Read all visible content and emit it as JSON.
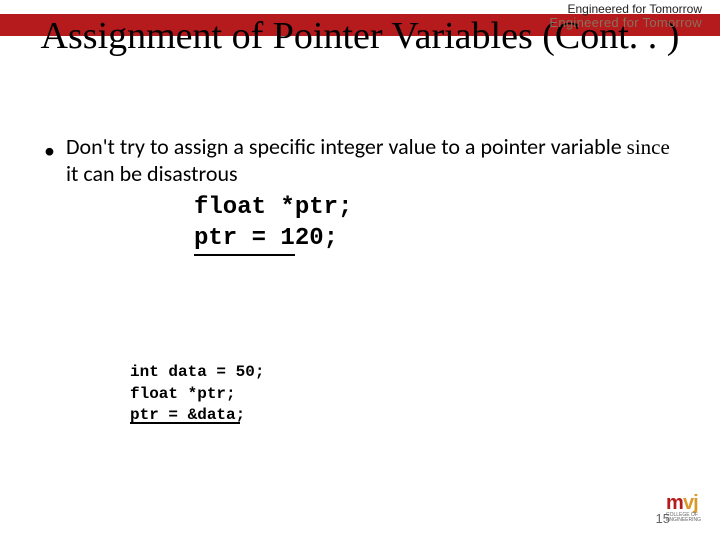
{
  "header": {
    "tagline1": "Engineered for Tomorrow",
    "tagline2": "Engineered for Tomorrow"
  },
  "title": "Assignment of Pointer Variables (Cont. . )",
  "bullet": {
    "lead": "Don't try to assign a specific integer value to a pointer variable ",
    "since": "since",
    "rest": " it can be disastrous"
  },
  "code_main": {
    "line1": "float *ptr;",
    "line2_a": "ptr = 1",
    "line2_b": "20;"
  },
  "code_example": {
    "line1": "int data = 50;",
    "line2": "float *ptr;",
    "line3": "ptr = &data;"
  },
  "page_number": "15",
  "logo": {
    "m": "m",
    "vj": "vj",
    "sub1": "COLLEGE OF",
    "sub2": "ENGINEERING"
  }
}
